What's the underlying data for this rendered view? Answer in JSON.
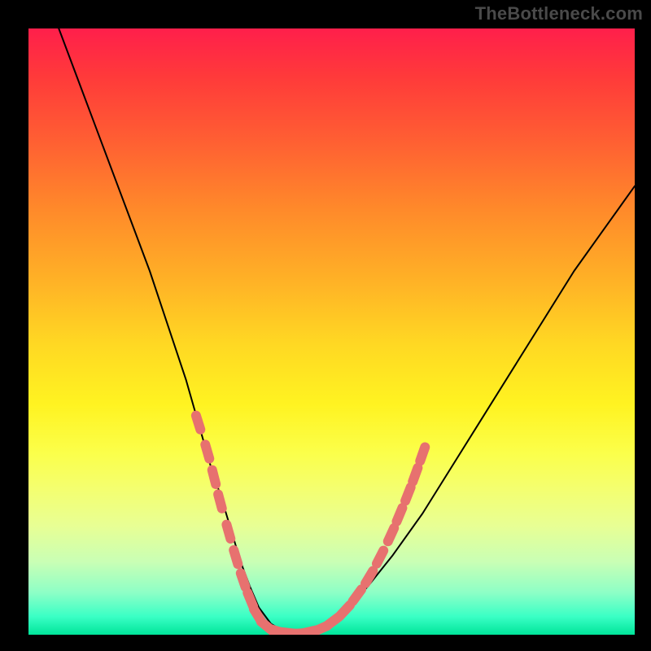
{
  "watermark": "TheBottleneck.com",
  "chart_data": {
    "type": "line",
    "title": "",
    "xlabel": "",
    "ylabel": "",
    "xlim": [
      0,
      100
    ],
    "ylim": [
      0,
      100
    ],
    "series": [
      {
        "name": "bottleneck-curve",
        "x": [
          5,
          8,
          11,
          14,
          17,
          20,
          23,
          26,
          28,
          30,
          32,
          33.5,
          35,
          36.5,
          38,
          40,
          42,
          45,
          48,
          52,
          56,
          60,
          65,
          70,
          75,
          80,
          85,
          90,
          95,
          100
        ],
        "y": [
          100,
          92,
          84,
          76,
          68,
          60,
          51,
          42,
          35,
          28,
          22,
          17,
          12,
          8,
          4.5,
          1.8,
          0.6,
          0.2,
          1.2,
          3.8,
          8,
          13,
          20,
          28,
          36,
          44,
          52,
          60,
          67,
          74
        ]
      }
    ],
    "markers": {
      "name": "highlight-points",
      "color": "#e7716f",
      "points": [
        {
          "x": 28.0,
          "y": 35.0
        },
        {
          "x": 29.5,
          "y": 30.2
        },
        {
          "x": 30.6,
          "y": 26.0
        },
        {
          "x": 31.6,
          "y": 22.0
        },
        {
          "x": 33.0,
          "y": 17.0
        },
        {
          "x": 34.2,
          "y": 12.8
        },
        {
          "x": 35.4,
          "y": 9.0
        },
        {
          "x": 36.6,
          "y": 5.8
        },
        {
          "x": 37.8,
          "y": 3.2
        },
        {
          "x": 39.3,
          "y": 1.4
        },
        {
          "x": 41.0,
          "y": 0.6
        },
        {
          "x": 42.8,
          "y": 0.3
        },
        {
          "x": 44.6,
          "y": 0.2
        },
        {
          "x": 46.4,
          "y": 0.5
        },
        {
          "x": 48.2,
          "y": 1.0
        },
        {
          "x": 50.2,
          "y": 2.2
        },
        {
          "x": 52.2,
          "y": 4.0
        },
        {
          "x": 54.2,
          "y": 6.5
        },
        {
          "x": 56.2,
          "y": 9.5
        },
        {
          "x": 58.0,
          "y": 12.8
        },
        {
          "x": 59.8,
          "y": 16.5
        },
        {
          "x": 61.2,
          "y": 19.8
        },
        {
          "x": 62.6,
          "y": 23.2
        },
        {
          "x": 63.8,
          "y": 26.4
        },
        {
          "x": 65.0,
          "y": 29.8
        }
      ]
    }
  }
}
